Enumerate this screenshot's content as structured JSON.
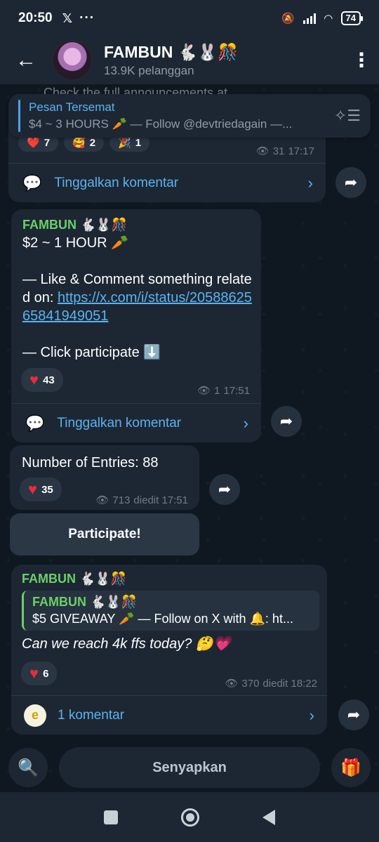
{
  "status_bar": {
    "time": "20:50",
    "x_icon": "𝕏",
    "dots": "···",
    "battery": "74"
  },
  "header": {
    "back": "←",
    "title": "FAMBUN 🐇🐰🎊",
    "subtitle": "13.9K pelanggan",
    "menu": "⋮"
  },
  "peek_text": "Check the full announcements at",
  "pinned": {
    "title": "Pesan Tersemat",
    "text": "$4 ~ 3 HOURS 🥕   — Follow @devtriedagain —..."
  },
  "msg0": {
    "reactions": [
      {
        "emoji": "❤️",
        "count": "7"
      },
      {
        "emoji": "🥰",
        "count": "2"
      },
      {
        "emoji": "🎉",
        "count": "1"
      }
    ],
    "views": "31",
    "time": "17:17",
    "comments": "Tinggalkan komentar"
  },
  "msg1": {
    "name": "FAMBUN 🐇🐰🎊",
    "line1": "$2 ~ 1 HOUR 🥕",
    "line2": "— Like & Comment something related on: ",
    "link": "https://x.com/i/status/2058862565841949051",
    "line3": "— Click participate ⬇️",
    "reaction_count": "43",
    "views": "1",
    "time": "17:51",
    "comments": "Tinggalkan komentar"
  },
  "msg2": {
    "text": "Number of Entries: 88",
    "reaction_count": "35",
    "views": "713",
    "time": "diedit 17:51"
  },
  "participate_button": "Participate!",
  "msg3": {
    "name": "FAMBUN 🐇🐰🎊",
    "quote_name": "FAMBUN 🐇🐰🎊",
    "quote_text": "$5 GIVEAWAY 🥕   — Follow on X with 🔔: ht...",
    "text": "Can we reach 4k ffs today? 🤔💗",
    "reaction_count": "6",
    "views": "370",
    "time": "diedit 18:22",
    "comments": "1 komentar"
  },
  "bottom": {
    "mute_label": "Senyapkan"
  }
}
